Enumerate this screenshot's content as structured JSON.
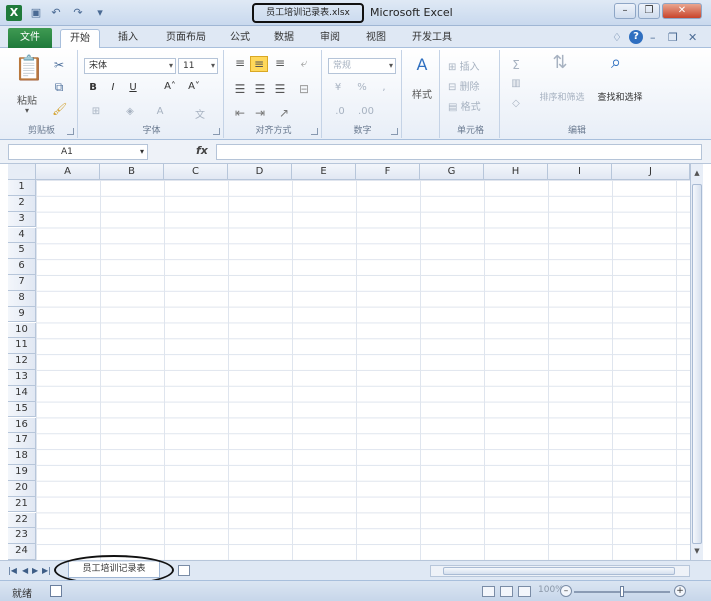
{
  "title": {
    "file": "员工培训记录表.xlsx",
    "app": "Microsoft Excel"
  },
  "tabs": [
    "文件",
    "开始",
    "插入",
    "页面布局",
    "公式",
    "数据",
    "审阅",
    "视图",
    "开发工具"
  ],
  "ribbon": {
    "paste": "粘贴",
    "font_name": "宋体",
    "font_size": "11",
    "number_format": "常规",
    "styles": "样式",
    "insert": "插入",
    "delete": "删除",
    "format": "格式",
    "sort_filter": "排序和筛选",
    "find_select": "查找和选择",
    "groups": {
      "clipboard": "剪贴板",
      "font": "字体",
      "alignment": "对齐方式",
      "number": "数字",
      "cells": "单元格",
      "editing": "编辑"
    }
  },
  "formula_bar": {
    "name_box": "A1",
    "fx": "fx"
  },
  "columns": [
    "A",
    "B",
    "C",
    "D",
    "E",
    "F",
    "G",
    "H",
    "I",
    "J"
  ],
  "rows": [
    "1",
    "2",
    "3",
    "4",
    "5",
    "6",
    "7",
    "8",
    "9",
    "10",
    "11",
    "12",
    "13",
    "14",
    "15",
    "16",
    "17",
    "18",
    "19",
    "20",
    "21",
    "22",
    "23",
    "24"
  ],
  "sheet_tab": "员工培训记录表",
  "status": {
    "ready": "就绪",
    "zoom": "100%"
  },
  "icons": [
    "excel-app-icon",
    "save-icon",
    "undo-icon",
    "redo-icon",
    "help-icon",
    "paste-icon",
    "cut-icon",
    "copy-icon",
    "format-painter-icon",
    "bold-icon",
    "italic-icon",
    "underline-icon",
    "sum-icon",
    "sort-icon",
    "find-icon"
  ]
}
